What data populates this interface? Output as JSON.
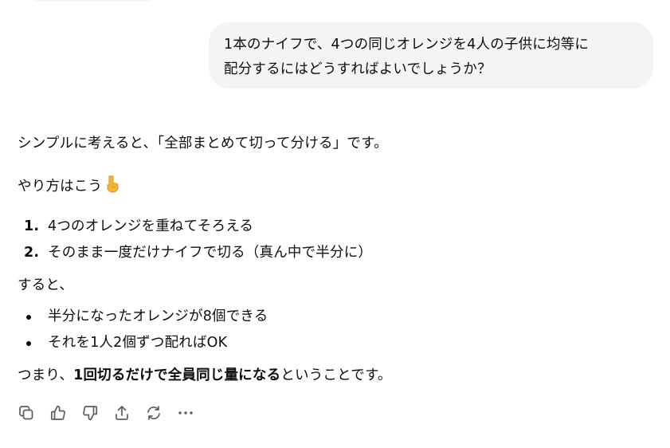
{
  "user_message": {
    "line1": "1本のナイフで、4つの同じオレンジを4人の子供に均等に",
    "line2": "配分するにはどうすればよいでしょうか？"
  },
  "assistant_message": {
    "intro": "シンプルに考えると、「全部まとめて切って分ける」です。",
    "method_label": "やり方はこう",
    "method_emoji": "👇",
    "steps": [
      {
        "num": "1.",
        "text": "4つのオレンジを重ねてそろえる"
      },
      {
        "num": "2.",
        "text": "そのまま一度だけナイフで切る（真ん中で半分に）"
      }
    ],
    "then_label": "すると、",
    "results": [
      "半分になったオレンジが8個できる",
      "それを1人2個ずつ配ればOK"
    ],
    "conclusion_prefix": "つまり、",
    "conclusion_bold": "1回切るだけで全員同じ量になる",
    "conclusion_suffix": "ということです。"
  },
  "actions": {
    "icons": [
      "copy-icon",
      "thumbs-up-icon",
      "thumbs-down-icon",
      "share-icon",
      "regenerate-icon",
      "more-icon"
    ]
  }
}
